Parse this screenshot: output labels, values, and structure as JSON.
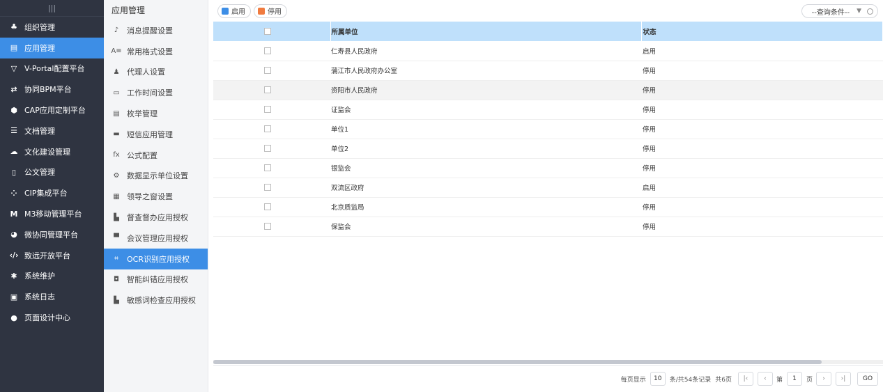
{
  "nav": {
    "top_icon": "|||",
    "items": [
      {
        "label": "组织管理",
        "icon": "sitemap-icon",
        "glyph": "♣"
      },
      {
        "label": "应用管理",
        "icon": "app-window-icon",
        "glyph": "▤",
        "active": true
      },
      {
        "label": "V-Portal配置平台",
        "icon": "portal-icon",
        "glyph": "▽"
      },
      {
        "label": "协同BPM平台",
        "icon": "bpm-flow-icon",
        "glyph": "⇄"
      },
      {
        "label": "CAP应用定制平台",
        "icon": "cap-icon",
        "glyph": "⬢"
      },
      {
        "label": "文档管理",
        "icon": "document-stack-icon",
        "glyph": "☰"
      },
      {
        "label": "文化建设管理",
        "icon": "culture-icon",
        "glyph": "☁"
      },
      {
        "label": "公文管理",
        "icon": "file-icon",
        "glyph": "▯"
      },
      {
        "label": "CIP集成平台",
        "icon": "integration-icon",
        "glyph": "⁘"
      },
      {
        "label": "M3移动管理平台",
        "icon": "m3-icon",
        "glyph": "M"
      },
      {
        "label": "微协同管理平台",
        "icon": "chat-icon",
        "glyph": "◕"
      },
      {
        "label": "致远开放平台",
        "icon": "code-icon",
        "glyph": "‹/›"
      },
      {
        "label": "系统维护",
        "icon": "gear-icon",
        "glyph": "✱"
      },
      {
        "label": "系统日志",
        "icon": "monitor-icon",
        "glyph": "▣"
      },
      {
        "label": "页面设计中心",
        "icon": "user-icon",
        "glyph": "●"
      }
    ]
  },
  "submenu": {
    "title": "应用管理",
    "items": [
      {
        "label": "消息提醒设置",
        "icon": "bell-icon",
        "glyph": "♪"
      },
      {
        "label": "常用格式设置",
        "icon": "format-icon",
        "glyph": "A≡"
      },
      {
        "label": "代理人设置",
        "icon": "agent-icon",
        "glyph": "♟"
      },
      {
        "label": "工作时间设置",
        "icon": "screen-clock-icon",
        "glyph": "▭"
      },
      {
        "label": "枚举管理",
        "icon": "list-doc-icon",
        "glyph": "▤"
      },
      {
        "label": "短信应用管理",
        "icon": "sms-icon",
        "glyph": "▬"
      },
      {
        "label": "公式配置",
        "icon": "fx-icon",
        "glyph": "fx"
      },
      {
        "label": "数据显示单位设置",
        "icon": "unit-icon",
        "glyph": "⚙"
      },
      {
        "label": "领导之窗设置",
        "icon": "window-icon",
        "glyph": "▦"
      },
      {
        "label": "督查督办应用授权",
        "icon": "supervise-icon",
        "glyph": "▙"
      },
      {
        "label": "会议管理应用授权",
        "icon": "meeting-icon",
        "glyph": "▀"
      },
      {
        "label": "OCR识别应用授权",
        "icon": "ocr-icon",
        "glyph": "⌗",
        "active": true
      },
      {
        "label": "智能纠错应用授权",
        "icon": "correction-icon",
        "glyph": "◘"
      },
      {
        "label": "敏感词检查应用授权",
        "icon": "sensitive-icon",
        "glyph": "▙"
      }
    ]
  },
  "toolbar": {
    "enable_label": "启用",
    "disable_label": "停用",
    "enable_color": "#3d8ee6",
    "disable_color": "#f07b3f",
    "search_placeholder": "--查询条件--"
  },
  "table": {
    "headers": {
      "unit": "所属单位",
      "status": "状态"
    },
    "rows": [
      {
        "unit": "仁寿县人民政府",
        "status": "启用"
      },
      {
        "unit": "蒲江市人民政府办公室",
        "status": "停用"
      },
      {
        "unit": "资阳市人民政府",
        "status": "停用"
      },
      {
        "unit": "证监会",
        "status": "停用"
      },
      {
        "unit": "单位1",
        "status": "停用"
      },
      {
        "unit": "单位2",
        "status": "停用"
      },
      {
        "unit": "银监会",
        "status": "停用"
      },
      {
        "unit": "双流区政府",
        "status": "启用"
      },
      {
        "unit": "北京质监局",
        "status": "停用"
      },
      {
        "unit": "保监会",
        "status": "停用"
      }
    ]
  },
  "pager": {
    "per_page_label": "每页显示",
    "per_page": "10",
    "summary": "条/共54条记录",
    "total_pages": "共6页",
    "first": "|‹",
    "prev": "‹",
    "page_prefix": "第",
    "page": "1",
    "page_suffix": "页",
    "next": "›",
    "last": "›|",
    "go": "GO"
  },
  "colors": {
    "nav_bg": "#2f3441",
    "accent": "#3d8ee6",
    "header_bg": "#bfe0fb"
  }
}
